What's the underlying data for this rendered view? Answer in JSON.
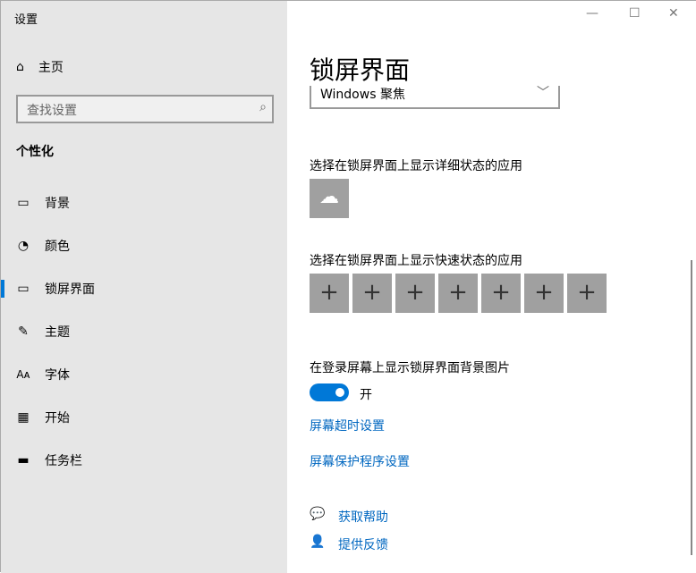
{
  "window": {
    "title": "设置",
    "minimize_icon": "minimize-icon",
    "maximize_icon": "maximize-icon",
    "close_icon": "close-icon"
  },
  "sidebar": {
    "home": "主页",
    "search_placeholder": "查找设置",
    "section": "个性化",
    "items": [
      {
        "label": "背景",
        "icon": "picture-icon"
      },
      {
        "label": "颜色",
        "icon": "palette-icon"
      },
      {
        "label": "锁屏界面",
        "icon": "lock-screen-icon",
        "selected": true
      },
      {
        "label": "主题",
        "icon": "theme-icon"
      },
      {
        "label": "字体",
        "icon": "font-icon"
      },
      {
        "label": "开始",
        "icon": "start-icon"
      },
      {
        "label": "任务栏",
        "icon": "taskbar-icon"
      }
    ]
  },
  "main": {
    "title": "锁屏界面",
    "background_select": "Windows 聚焦",
    "detailed_label": "选择在锁屏界面上显示详细状态的应用",
    "quick_label": "选择在锁屏界面上显示快速状态的应用",
    "quick_slots": [
      "+",
      "+",
      "+",
      "+",
      "+",
      "+",
      "+"
    ],
    "signin_bg_label": "在登录屏幕上显示锁屏界面背景图片",
    "toggle_state": "开",
    "toggle_on": true,
    "timeout_link": "屏幕超时设置",
    "screensaver_link": "屏幕保护程序设置",
    "help": "获取帮助",
    "feedback": "提供反馈"
  },
  "colors": {
    "accent": "#0078d7",
    "sidebar_bg": "#e6e6e6",
    "tile": "#a0a0a0"
  }
}
